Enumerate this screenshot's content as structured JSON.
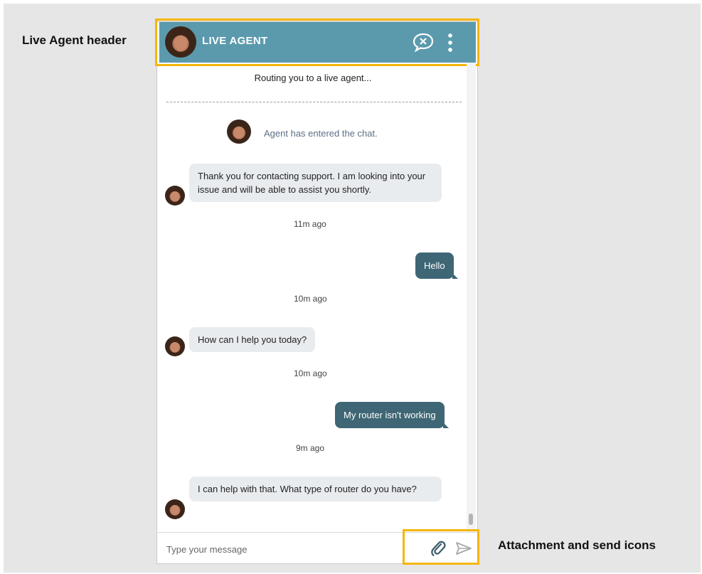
{
  "annotations": {
    "header_label": "Live Agent header",
    "icons_label": "Attachment and send icons"
  },
  "header": {
    "title": "LIVE AGENT",
    "color": "#5b9aad",
    "icons": [
      "agent-avatar",
      "end-chat-icon",
      "more-vertical-icon"
    ]
  },
  "highlight_color": "#f5b50a",
  "conversation": {
    "routing_text": "Routing you to a live agent...",
    "agent_entered": "Agent has entered the chat.",
    "messages": [
      {
        "from": "agent",
        "text": "Thank you for contacting support.  I am looking into your issue and will be able to assist you shortly.",
        "time": "11m ago"
      },
      {
        "from": "user",
        "text": "Hello",
        "time": "10m ago"
      },
      {
        "from": "agent",
        "text": "How can I help you today?",
        "time": "10m ago"
      },
      {
        "from": "user",
        "text": "My router isn't working",
        "time": "9m ago"
      },
      {
        "from": "agent",
        "text": "I can help with that. What type of router do you have?"
      }
    ]
  },
  "composer": {
    "placeholder": "Type your message",
    "icons": [
      "paperclip-icon",
      "send-icon"
    ]
  }
}
